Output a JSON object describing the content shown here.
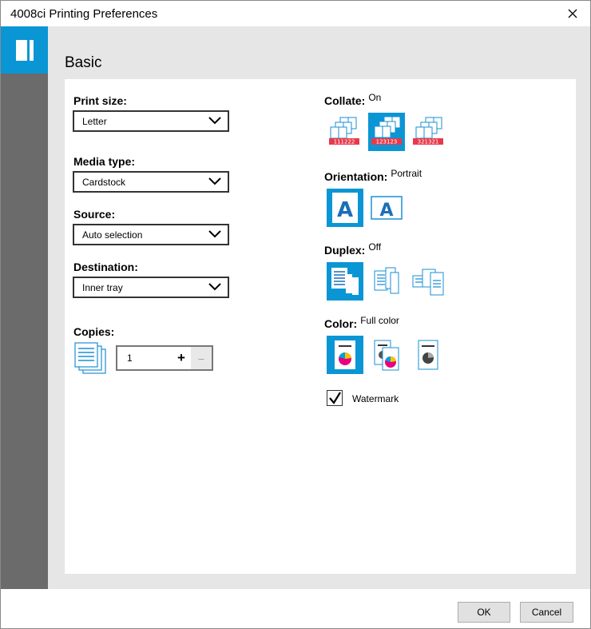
{
  "window": {
    "title": "4008ci Printing Preferences",
    "close_icon": "close-icon"
  },
  "sidebar": {
    "items": [
      {
        "icon": "document-icon",
        "selected": true
      }
    ]
  },
  "section_title": "Basic",
  "print_size": {
    "label": "Print size:",
    "value": "Letter"
  },
  "media_type": {
    "label": "Media type:",
    "value": "Cardstock"
  },
  "source": {
    "label": "Source:",
    "value": "Auto selection"
  },
  "destination": {
    "label": "Destination:",
    "value": "Inner tray"
  },
  "copies": {
    "label": "Copies:",
    "value": "1",
    "plus": "+",
    "minus": "–"
  },
  "collate": {
    "label": "Collate:",
    "value": "On",
    "options": [
      {
        "icon": "collate-off-icon",
        "caption": "111222"
      },
      {
        "icon": "collate-on-icon",
        "caption": "123123"
      },
      {
        "icon": "collate-reverse-icon",
        "caption": "321321"
      }
    ],
    "selected_index": 1
  },
  "orientation": {
    "label": "Orientation:",
    "value": "Portrait",
    "options": [
      {
        "icon": "portrait-icon",
        "glyph": "A"
      },
      {
        "icon": "landscape-icon",
        "glyph": "A"
      }
    ],
    "selected_index": 0
  },
  "duplex": {
    "label": "Duplex:",
    "value": "Off",
    "options": [
      {
        "icon": "duplex-off-icon"
      },
      {
        "icon": "duplex-long-edge-icon"
      },
      {
        "icon": "duplex-short-edge-icon"
      }
    ],
    "selected_index": 0
  },
  "color": {
    "label": "Color:",
    "value": "Full color",
    "options": [
      {
        "icon": "full-color-icon"
      },
      {
        "icon": "auto-color-icon"
      },
      {
        "icon": "grayscale-icon"
      }
    ],
    "selected_index": 0
  },
  "watermark": {
    "label": "Watermark",
    "checked": true
  },
  "footer": {
    "ok_label": "OK",
    "cancel_label": "Cancel"
  },
  "colors": {
    "accent": "#0a96d4",
    "sidebar": "#6b6b6b",
    "content_bg": "#e6e6e6",
    "icon_blue": "#1a8fd6",
    "red": "#e8394a",
    "pie_yellow": "#f5c400",
    "pie_magenta": "#e6007e",
    "pie_cyan": "#00a0e0"
  }
}
